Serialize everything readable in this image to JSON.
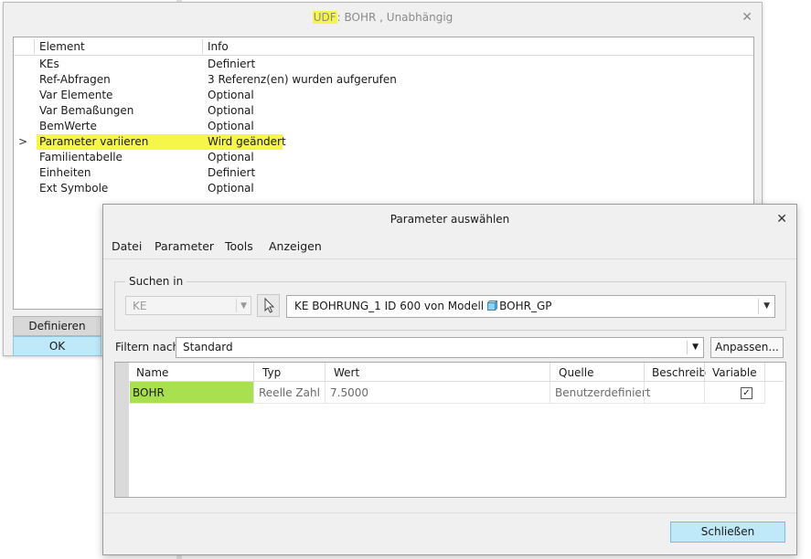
{
  "udf_dialog": {
    "title_prefix": "UDF",
    "title_rest": ": BOHR , Unabhängig",
    "close_glyph": "✕",
    "columns": [
      "Element",
      "Info"
    ],
    "selected_marker": ">",
    "rows": [
      {
        "element": "KEs",
        "info": "Definiert"
      },
      {
        "element": "Ref-Abfragen",
        "info": "3 Referenz(en) wurden aufgerufen"
      },
      {
        "element": "Var Elemente",
        "info": "Optional"
      },
      {
        "element": "Var Bemaßungen",
        "info": "Optional"
      },
      {
        "element": "BemWerte",
        "info": "Optional"
      },
      {
        "element": "Parameter variieren",
        "info": "Wird geändert"
      },
      {
        "element": "Familientabelle",
        "info": "Optional"
      },
      {
        "element": "Einheiten",
        "info": "Definiert"
      },
      {
        "element": "Ext Symbole",
        "info": "Optional"
      }
    ],
    "buttons": {
      "define": "Definieren",
      "ok": "OK"
    },
    "highlight_color": "#f5f54a"
  },
  "param_dialog": {
    "title": "Parameter auswählen",
    "close_glyph": "✕",
    "menu": [
      "Datei",
      "Parameter",
      "Tools",
      "Anzeigen"
    ],
    "search_in": {
      "label": "Suchen in",
      "scope": "KE",
      "feature_text": "KE BOHRUNG_1 ID 600 von Modell",
      "model_name": "BOHR_GP"
    },
    "filter": {
      "label": "Filtern nach",
      "value": "Standard",
      "customize_label": "Anpassen..."
    },
    "table": {
      "columns": [
        "Name",
        "Typ",
        "Wert",
        "Quelle",
        "Beschreib",
        "Variable"
      ],
      "rows": [
        {
          "name": "BOHR",
          "type": "Reelle Zahl",
          "value": "7.5000",
          "source": "Benutzerdefiniert",
          "description": "",
          "variable": true
        }
      ]
    },
    "close_label": "Schließen",
    "name_highlight_color": "#a8e050",
    "accent_button_color": "#bfe8f8"
  }
}
